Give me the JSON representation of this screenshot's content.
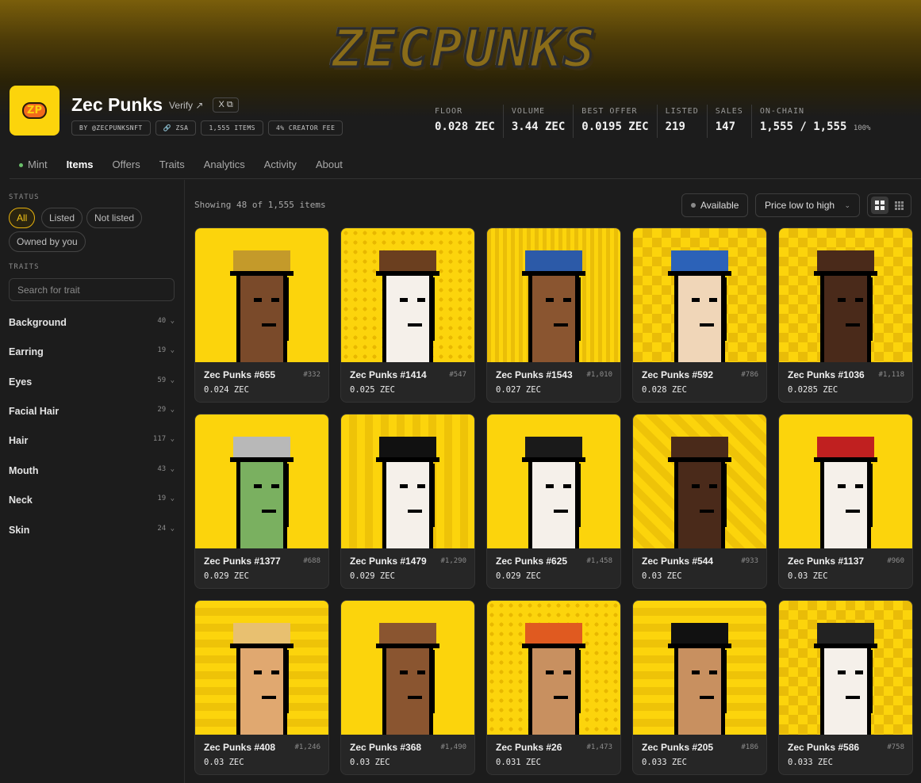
{
  "banner": {
    "logo_text": "ZECPUNKS"
  },
  "collection": {
    "avatar_text": "ZP",
    "title": "Zec Punks",
    "verify_label": "Verify ↗",
    "x_label": "X ⧉",
    "tags": [
      "BY @ZECPUNKSNFT",
      "🔗 ZSA",
      "1,555 ITEMS",
      "4% CREATOR FEE"
    ]
  },
  "stats": [
    {
      "label": "FLOOR",
      "value": "0.028 ZEC"
    },
    {
      "label": "VOLUME",
      "value": "3.44 ZEC"
    },
    {
      "label": "BEST OFFER",
      "value": "0.0195 ZEC"
    },
    {
      "label": "LISTED",
      "value": "219"
    },
    {
      "label": "SALES",
      "value": "147"
    },
    {
      "label": "ON-CHAIN",
      "value": "1,555 / 1,555",
      "suffix": "100%"
    }
  ],
  "tabs": [
    "Mint",
    "Items",
    "Offers",
    "Traits",
    "Analytics",
    "Activity",
    "About"
  ],
  "sidebar": {
    "status_heading": "STATUS",
    "status_filters": [
      "All",
      "Listed",
      "Not listed",
      "Owned by you"
    ],
    "traits_heading": "TRAITS",
    "search_placeholder": "Search for trait",
    "traits": [
      {
        "name": "Background",
        "count": "40 ⌄"
      },
      {
        "name": "Earring",
        "count": "19 ⌄"
      },
      {
        "name": "Eyes",
        "count": "59 ⌄"
      },
      {
        "name": "Facial Hair",
        "count": "29 ⌄"
      },
      {
        "name": "Hair",
        "count": "117 ⌄"
      },
      {
        "name": "Mouth",
        "count": "43 ⌄"
      },
      {
        "name": "Neck",
        "count": "19 ⌄"
      },
      {
        "name": "Skin",
        "count": "24 ⌄"
      }
    ]
  },
  "toolbar": {
    "showing": "Showing 48 of 1,555 items",
    "available_label": "Available",
    "sort_label": "Price low to high",
    "sort_chevron": "⌄"
  },
  "items": [
    {
      "name": "Zec Punks #655",
      "rank": "#332",
      "price": "0.024 ZEC",
      "skin": "#7a4a2a",
      "hat": "#c49a2a",
      "bg": "plain"
    },
    {
      "name": "Zec Punks #1414",
      "rank": "#547",
      "price": "0.025 ZEC",
      "skin": "#f5f0ea",
      "hat": "#6b3f1f",
      "bg": "dots"
    },
    {
      "name": "Zec Punks #1543",
      "rank": "#1,010",
      "price": "0.027 ZEC",
      "skin": "#8a5530",
      "hat": "#2c5aa8",
      "bg": "grid"
    },
    {
      "name": "Zec Punks #592",
      "rank": "#786",
      "price": "0.028 ZEC",
      "skin": "#f0d6b8",
      "hat": "#2c62b8",
      "bg": "checker"
    },
    {
      "name": "Zec Punks #1036",
      "rank": "#1,118",
      "price": "0.0285 ZEC",
      "skin": "#4a2a1a",
      "hat": "#4a2a1a",
      "bg": "checker"
    },
    {
      "name": "Zec Punks #1377",
      "rank": "#688",
      "price": "0.029 ZEC",
      "skin": "#7ab060",
      "hat": "#b8b8b8",
      "bg": "plain"
    },
    {
      "name": "Zec Punks #1479",
      "rank": "#1,290",
      "price": "0.029 ZEC",
      "skin": "#f5f0ea",
      "hat": "#111111",
      "bg": "stripes"
    },
    {
      "name": "Zec Punks #625",
      "rank": "#1,458",
      "price": "0.029 ZEC",
      "skin": "#f5f0ea",
      "hat": "#1a1a1a",
      "bg": "plain"
    },
    {
      "name": "Zec Punks #544",
      "rank": "#933",
      "price": "0.03 ZEC",
      "skin": "#4a2a1a",
      "hat": "#4a2a1a",
      "bg": "diag"
    },
    {
      "name": "Zec Punks #1137",
      "rank": "#960",
      "price": "0.03 ZEC",
      "skin": "#f5f0ea",
      "hat": "#c02020",
      "bg": "plain"
    },
    {
      "name": "Zec Punks #408",
      "rank": "#1,246",
      "price": "0.03 ZEC",
      "skin": "#e0a870",
      "hat": "#e8c070",
      "bg": "hstripes"
    },
    {
      "name": "Zec Punks #368",
      "rank": "#1,490",
      "price": "0.03 ZEC",
      "skin": "#8a5530",
      "hat": "#8a5530",
      "bg": "plain"
    },
    {
      "name": "Zec Punks #26",
      "rank": "#1,473",
      "price": "0.031 ZEC",
      "skin": "#c89060",
      "hat": "#e05a20",
      "bg": "dots"
    },
    {
      "name": "Zec Punks #205",
      "rank": "#186",
      "price": "0.033 ZEC",
      "skin": "#c89060",
      "hat": "#111111",
      "bg": "hstripes"
    },
    {
      "name": "Zec Punks #586",
      "rank": "#758",
      "price": "0.033 ZEC",
      "skin": "#f5f0ea",
      "hat": "#222222",
      "bg": "checker"
    }
  ]
}
